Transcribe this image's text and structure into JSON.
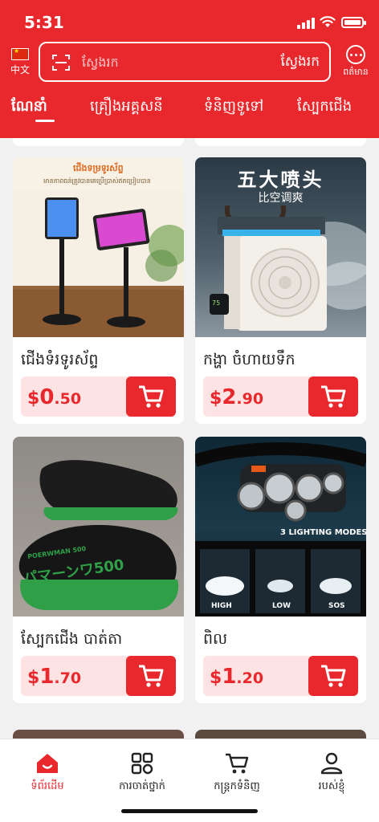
{
  "status_bar": {
    "time": "5:31"
  },
  "header": {
    "language_label": "中文",
    "search": {
      "placeholder": "ស្វែងរក",
      "button_label": "ស្វែងរក"
    },
    "more_label": "ពត៌មាន",
    "tabs": [
      {
        "label": "ណែនាំ",
        "active": true
      },
      {
        "label": "គ្រឿងអគ្គសនី"
      },
      {
        "label": "ទំនិញទូទៅ"
      },
      {
        "label": "ស្បែកជើង"
      }
    ]
  },
  "products": [
    {
      "name": "ជើងទំរទូរស័ព្ទ",
      "price": {
        "currency": "$",
        "integer": "0",
        "decimal": ".50"
      },
      "image": {
        "title": "ជើងទម្រទូរស័ព្ទ",
        "subtitle": "មានភាពធន់ត្រូវបានគេប្រើប្រាស់ឥតប្រៀបបាន"
      }
    },
    {
      "name": "កង្ហា ចំហាយទឹក",
      "price": {
        "currency": "$",
        "integer": "2",
        "decimal": ".90"
      },
      "image": {
        "title": "五大喷头",
        "subtitle": "比空调爽",
        "screen": "75"
      }
    },
    {
      "name": "ស្បែកជើង បាត់តា",
      "price": {
        "currency": "$",
        "integer": "1",
        "decimal": ".70"
      },
      "image": {
        "brand": "POERWMAN 500",
        "brand_jp": "パマーンワ500"
      }
    },
    {
      "name": "ពិល",
      "price": {
        "currency": "$",
        "integer": "1",
        "decimal": ".20"
      },
      "image": {
        "title": "3 LIGHTING MODES",
        "modes": [
          "HIGH",
          "LOW",
          "SOS"
        ]
      }
    }
  ],
  "bottom_nav": [
    {
      "label": "ទំព័រដើម",
      "icon": "home-icon",
      "active": true
    },
    {
      "label": "ការចាត់ថ្នាក់",
      "icon": "category-icon"
    },
    {
      "label": "កន្ត្រកទំនិញ",
      "icon": "cart-icon"
    },
    {
      "label": "របស់ខ្ញុំ",
      "icon": "user-icon"
    }
  ],
  "colors": {
    "brand_red": "#e8282c",
    "price_bg": "#fde3e3",
    "page_bg": "#f1f1f1"
  }
}
